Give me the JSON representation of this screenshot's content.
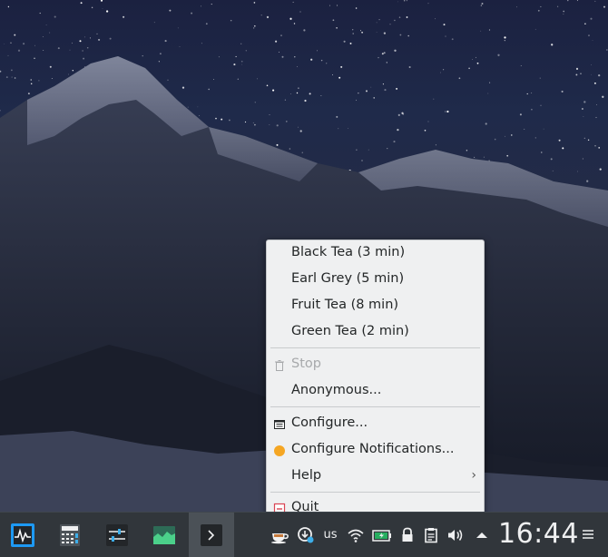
{
  "menu": {
    "teas": [
      {
        "label": "Black Tea (3 min)"
      },
      {
        "label": "Earl Grey (5 min)"
      },
      {
        "label": "Fruit Tea (8 min)"
      },
      {
        "label": "Green Tea (2 min)"
      }
    ],
    "stop_label": "Stop",
    "anonymous_label": "Anonymous...",
    "configure_label": "Configure...",
    "configure_notifications_label": "Configure Notifications...",
    "help_label": "Help",
    "quit_label": "Quit"
  },
  "taskbar": {
    "tasks": [
      {
        "icon": "system-monitor-icon"
      },
      {
        "icon": "calculator-icon"
      },
      {
        "icon": "settings-sliders-icon"
      },
      {
        "icon": "graph-icon"
      },
      {
        "icon": "terminal-icon",
        "active": true
      }
    ],
    "tray": {
      "keyboard_layout": "us",
      "icons": [
        "tea-cup-icon",
        "updates-icon",
        "wifi-icon",
        "battery-icon",
        "lock-icon",
        "clipboard-icon",
        "volume-icon",
        "show-hidden-arrow-icon"
      ]
    },
    "clock": "16:44"
  },
  "colors": {
    "panel": "#31363b",
    "menu_bg": "#eff0f1",
    "accent_red": "#da4453",
    "accent_orange": "#f5a623",
    "highlight": "#3daee9"
  }
}
